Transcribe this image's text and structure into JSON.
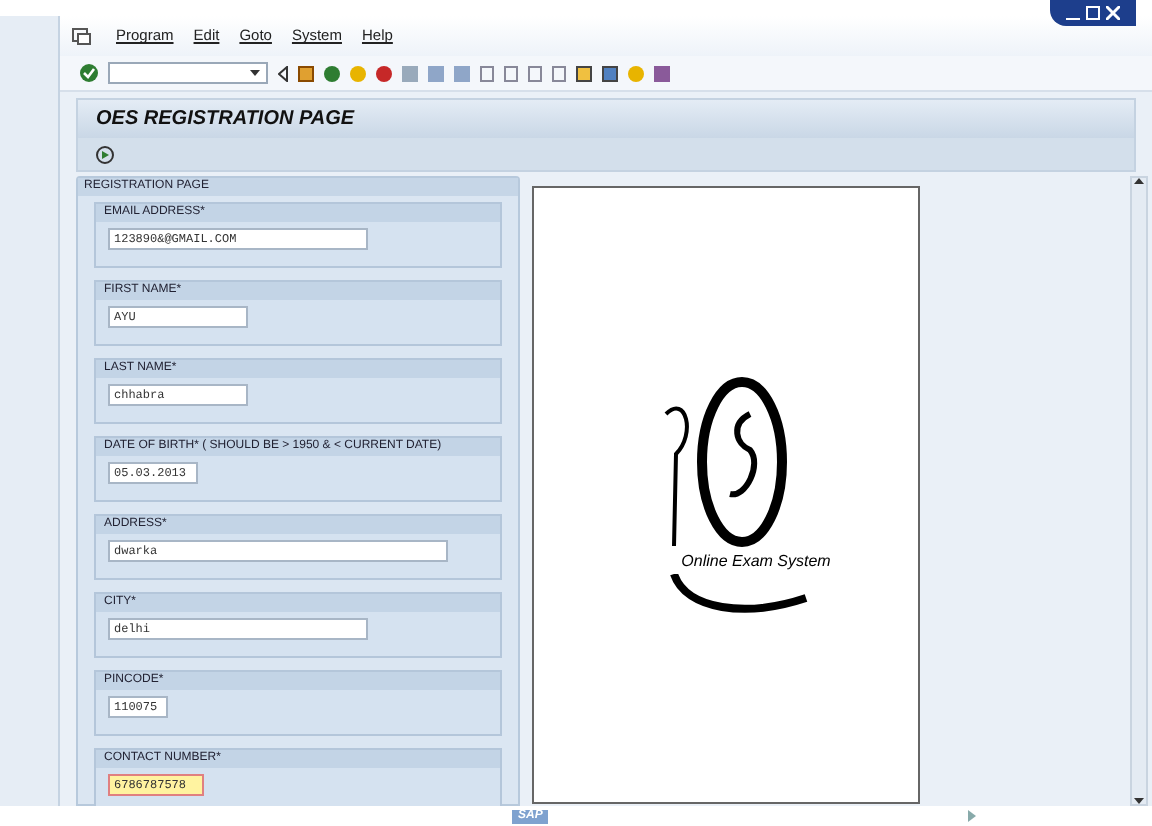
{
  "menu": [
    "Program",
    "Edit",
    "Goto",
    "System",
    "Help"
  ],
  "title": "OES REGISTRATION PAGE",
  "panel_title": "REGISTRATION PAGE",
  "fields": [
    {
      "label": "EMAIL ADDRESS*",
      "value": "123890&@GMAIL.COM",
      "focused": false
    },
    {
      "label": "FIRST NAME*",
      "value": "AYU",
      "focused": false
    },
    {
      "label": "LAST NAME*",
      "value": "chhabra",
      "focused": false
    },
    {
      "label": "DATE OF BIRTH* ( SHOULD BE > 1950 & < CURRENT DATE)",
      "value": "05.03.2013",
      "focused": false
    },
    {
      "label": "ADDRESS*",
      "value": "dwarka",
      "focused": false
    },
    {
      "label": "CITY*",
      "value": "delhi",
      "focused": false
    },
    {
      "label": "PINCODE*",
      "value": "110075",
      "focused": false
    },
    {
      "label": "CONTACT NUMBER*",
      "value": "6786787578",
      "focused": true
    }
  ],
  "logo_text": "Online Exam System",
  "status_bar": {
    "brand": "SAP"
  }
}
